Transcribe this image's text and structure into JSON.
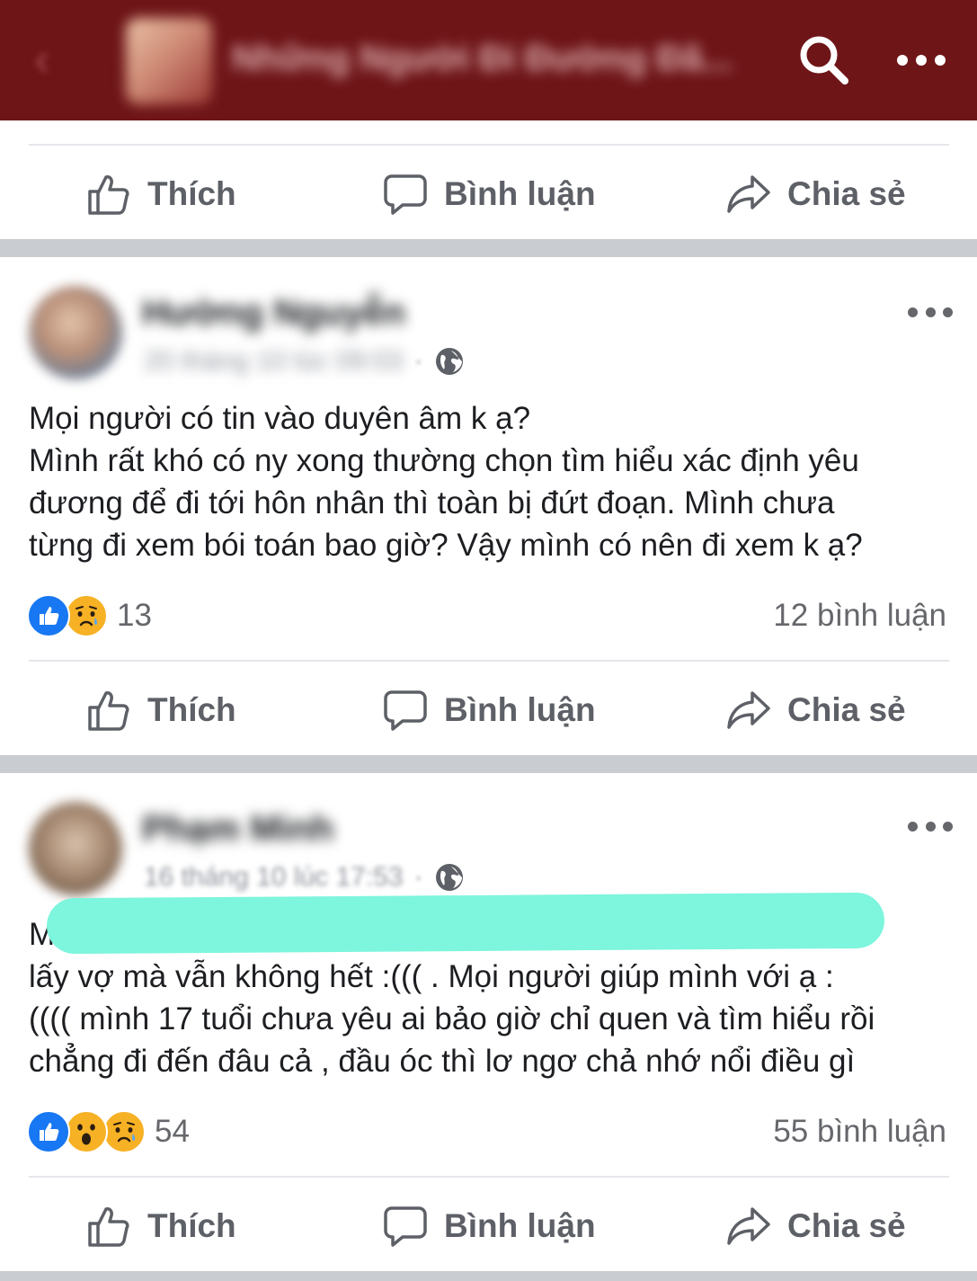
{
  "header": {
    "back_label": "‹",
    "group_title": "Những Người Đi Đường Đã...",
    "colors": {
      "bar": "#6e1518",
      "icons": "#ffffff"
    }
  },
  "actions": {
    "like": "Thích",
    "comment": "Bình luận",
    "share": "Chia sẻ"
  },
  "posts": [
    {
      "author": "Hường Nguyễn",
      "time": "20 tháng 10 lúc 09:03",
      "privacy_icon": "globe-icon",
      "text_lines": [
        "Mọi người có tin vào duyên âm k ạ?",
        "Mình rất khó có ny xong thường chọn tìm hiểu xác định yêu",
        "đương để đi tới hôn nhân thì toàn bị đứt đoạn. Mình chưa",
        "từng đi xem bói toán bao giờ? Vậy mình có nên đi xem k ạ?"
      ],
      "reactions": [
        "like",
        "sad"
      ],
      "reaction_count": "13",
      "comment_count": "12 bình luận"
    },
    {
      "author": "Phạm Minh",
      "time": "16 tháng 10 lúc 17:53",
      "privacy_icon": "globe-icon",
      "text_lines": [
        "M                                                                              n",
        "lấy vợ mà vẫn không hết :((( . Mọi người giúp mình với ạ :",
        "(((( mình 17 tuổi chưa yêu ai bảo giờ chỉ quen và tìm hiểu rồi",
        "chẳng đi đến đâu cả , đầu óc thì lơ ngơ chả nhớ nổi điều gì"
      ],
      "reactions": [
        "like",
        "wow",
        "sad"
      ],
      "reaction_count": "54",
      "comment_count": "55 bình luận"
    }
  ]
}
